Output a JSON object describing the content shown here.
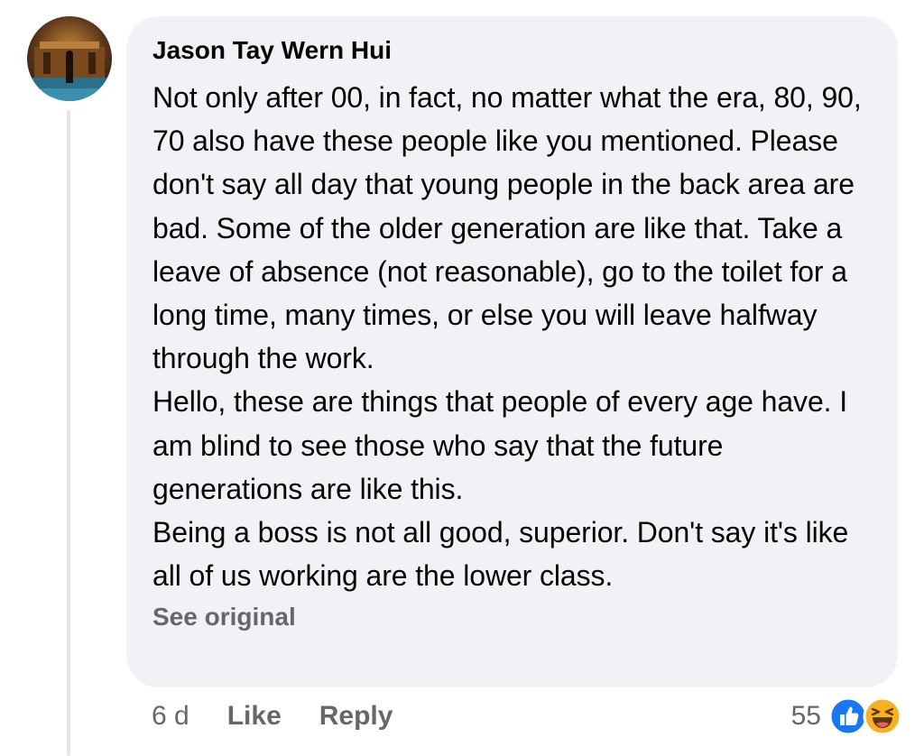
{
  "comment": {
    "author": "Jason Tay Wern Hui",
    "paragraphs": [
      "Not only after 00, in fact, no matter what the era, 80, 90, 70 also have these people like you mentioned. Please don't say all day that young people in the back area are bad. Some of the older generation are like that. Take a leave of absence (not reasonable), go to the toilet for a long time, many times, or else you will leave halfway through the work.",
      "Hello, these are things that people of every age have. I am blind to see those who say that the future generations are like this.",
      "Being a boss is not all good, superior. Don't say it's like all of us working are the lower class."
    ],
    "see_original_label": "See original",
    "time": "6 d",
    "like_label": "Like",
    "reply_label": "Reply",
    "reaction_count": "55",
    "reaction_icons": [
      "like-reaction-icon",
      "haha-reaction-icon"
    ]
  },
  "colors": {
    "bubble_bg": "#f0f2f5",
    "text_primary": "#050505",
    "text_secondary": "#65676b",
    "like_blue": "#1877f2",
    "haha_yellow": "#f7b125"
  }
}
